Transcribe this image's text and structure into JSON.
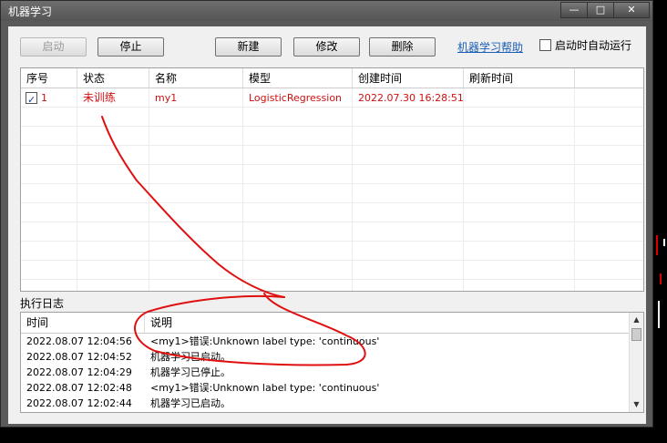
{
  "window": {
    "title": "机器学习",
    "controls": [
      "—",
      "□",
      "✕"
    ]
  },
  "toolbar": {
    "start": "启动",
    "stop": "停止",
    "new": "新建",
    "edit": "修改",
    "delete": "删除",
    "help": "机器学习帮助",
    "autorun": "启动时自动运行"
  },
  "models": {
    "columns": [
      "序号",
      "状态",
      "名称",
      "模型",
      "创建时间",
      "刷新时间"
    ],
    "rows": [
      {
        "checked": true,
        "index": "1",
        "status": "未训练",
        "name": "my1",
        "model": "LogisticRegression",
        "created": "2022.07.30 16:28:51",
        "refreshed": ""
      }
    ]
  },
  "log": {
    "label": "执行日志",
    "columns": [
      "时间",
      "说明"
    ],
    "rows": [
      {
        "time": "2022.08.07 12:04:56",
        "message": "<my1>错误:Unknown label type: 'continuous'"
      },
      {
        "time": "2022.08.07 12:04:52",
        "message": "机器学习已启动。"
      },
      {
        "time": "2022.08.07 12:04:29",
        "message": "机器学习已停止。"
      },
      {
        "time": "2022.08.07 12:02:48",
        "message": "<my1>错误:Unknown label type: 'continuous'"
      },
      {
        "time": "2022.08.07 12:02:44",
        "message": "机器学习已启动。"
      }
    ]
  },
  "colors": {
    "status_red": "#d01010",
    "annotation_red": "#e01010",
    "link_blue": "#1a5fb4"
  }
}
